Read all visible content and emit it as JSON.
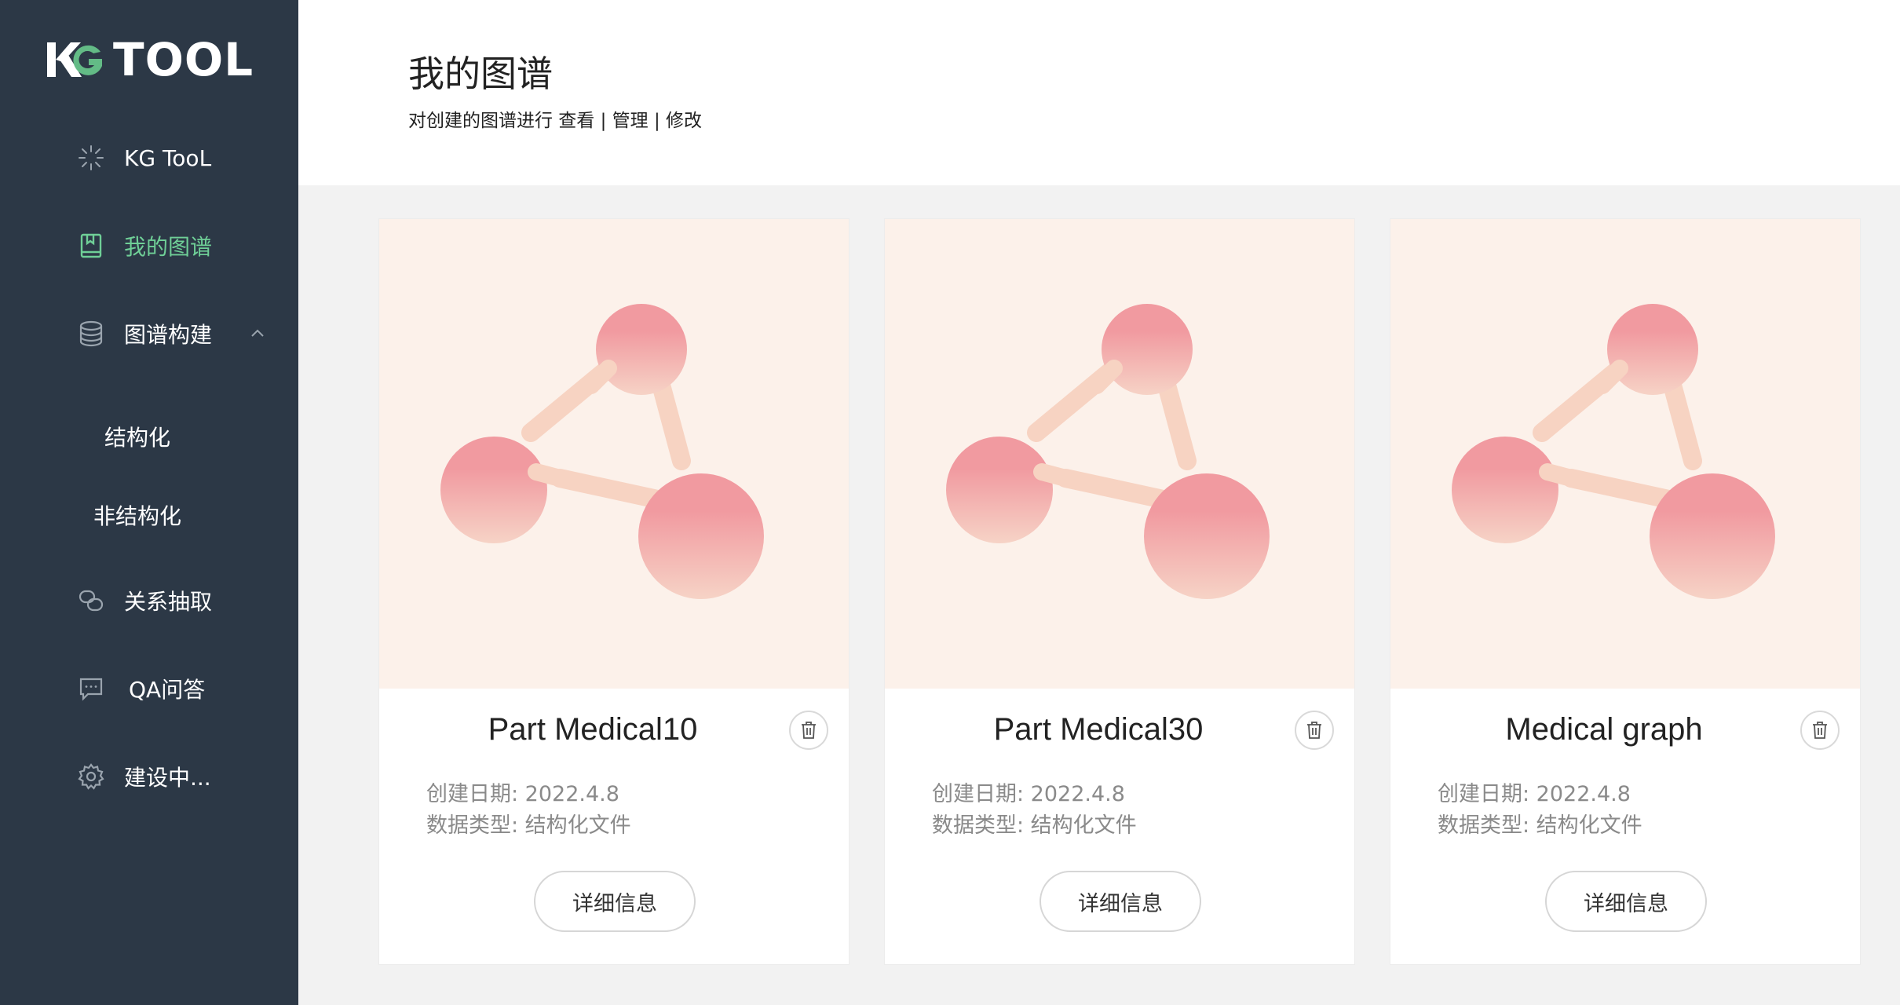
{
  "sidebar": {
    "logo_text": "TOOL",
    "logo_mark": "KG",
    "active_color": "#6fcf97",
    "background": "#2c3846",
    "items": [
      {
        "label": "KG TooL",
        "icon": "sparkle-icon"
      },
      {
        "label": "我的图谱",
        "icon": "book-icon",
        "active": true
      },
      {
        "label": "图谱构建",
        "icon": "database-icon",
        "expanded": true
      },
      {
        "label": "关系抽取",
        "icon": "link-icon"
      },
      {
        "label": "QA问答",
        "icon": "chat-icon"
      },
      {
        "label": "建设中...",
        "icon": "gear-icon"
      }
    ],
    "sub_items": [
      {
        "label": "结构化"
      },
      {
        "label": "非结构化"
      }
    ]
  },
  "header": {
    "title": "我的图谱",
    "subtitle": "对创建的图谱进行 查看 | 管理 | 修改"
  },
  "cards": [
    {
      "title": "Part Medical10",
      "date_label": "创建日期: 2022.4.8",
      "type_label": "数据类型: 结构化文件",
      "button_label": "详细信息"
    },
    {
      "title": "Part Medical30",
      "date_label": "创建日期: 2022.4.8",
      "type_label": "数据类型: 结构化文件",
      "button_label": "详细信息"
    },
    {
      "title": "Medical graph",
      "date_label": "创建日期: 2022.4.8",
      "type_label": "数据类型: 结构化文件",
      "button_label": "详细信息"
    }
  ],
  "colors": {
    "card_image_bg": "#fcf1ea",
    "node_top": "#f19aa0",
    "node_bottom": "#f6d3c6",
    "edge": "#f7d3c2"
  }
}
